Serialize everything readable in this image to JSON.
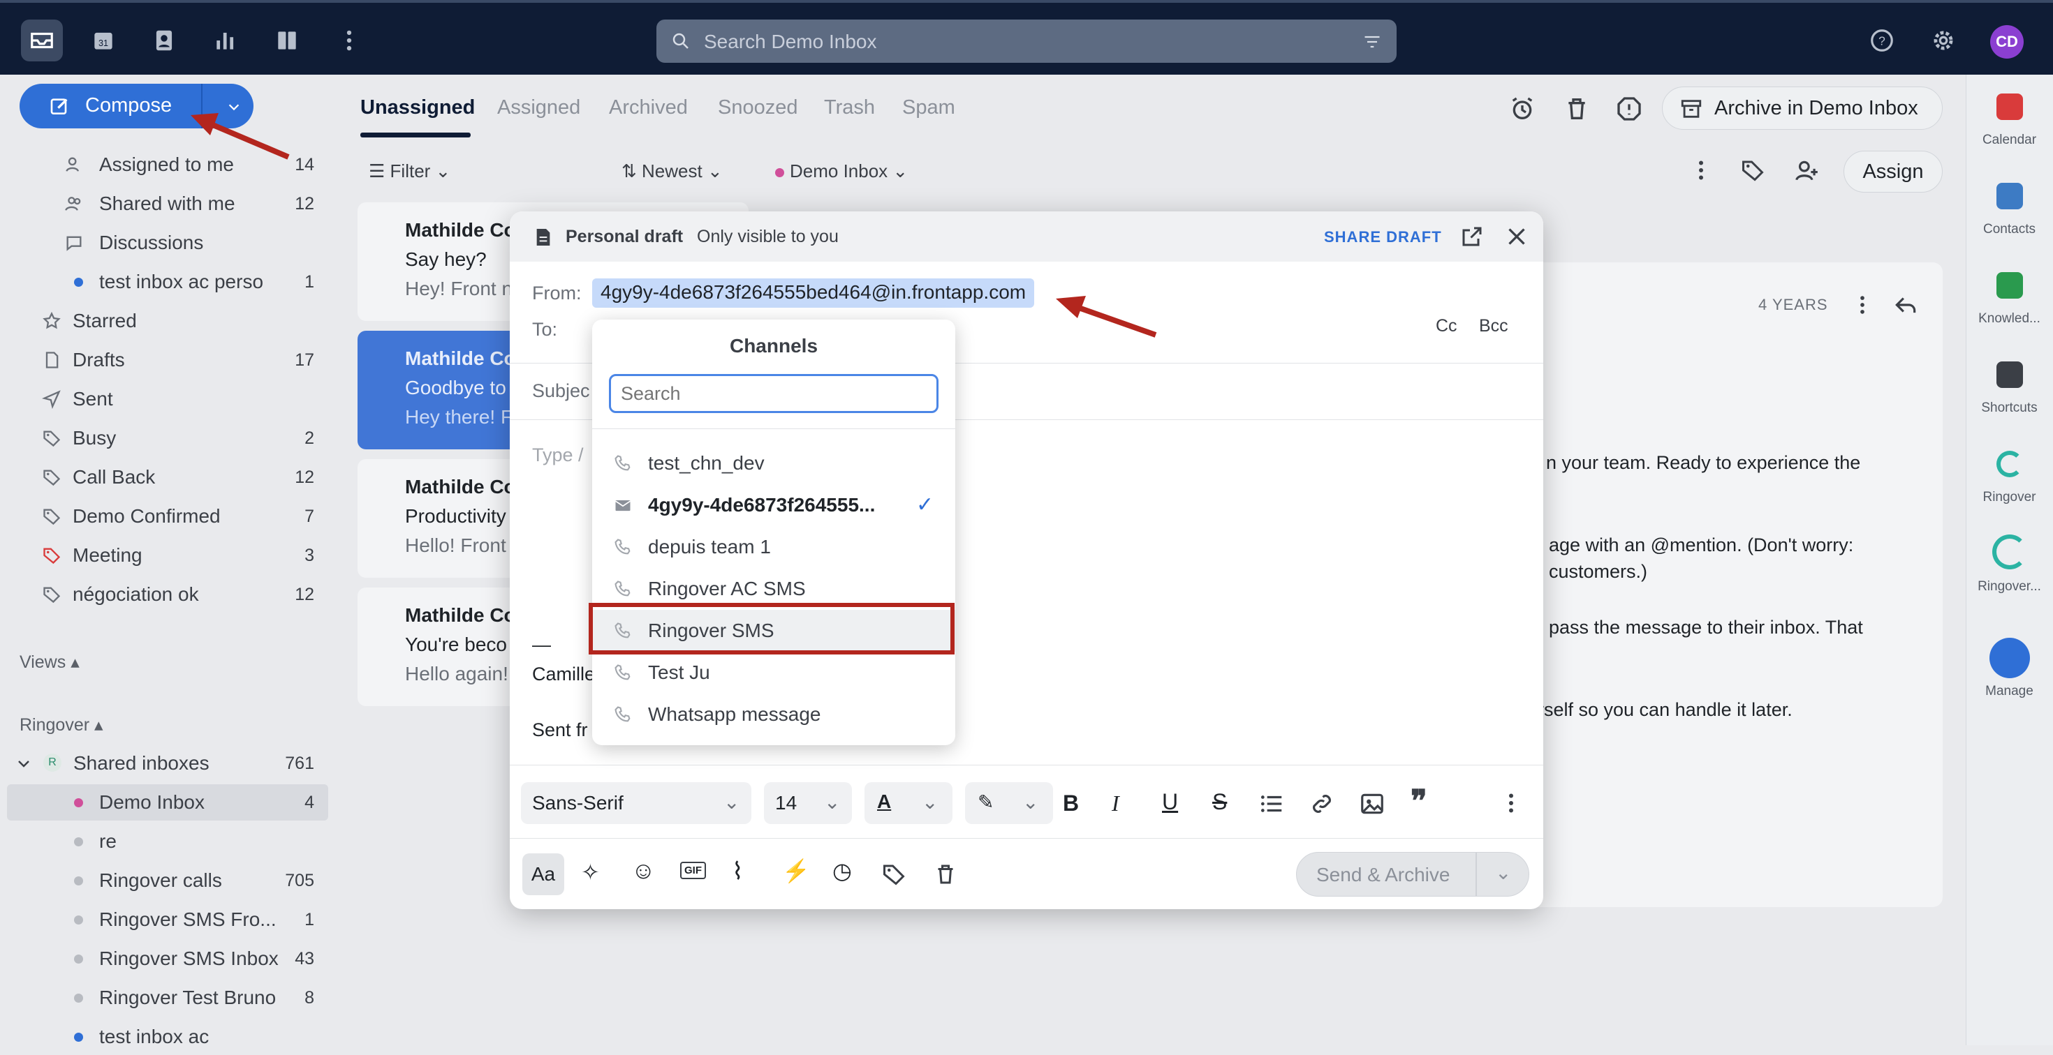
{
  "search": {
    "placeholder": "Search Demo Inbox"
  },
  "user": {
    "initials": "CD"
  },
  "compose": {
    "label": "Compose"
  },
  "sidebar": {
    "items": [
      {
        "label": "Assigned to me",
        "count": "14",
        "icon": "assigned-icon"
      },
      {
        "label": "Shared with me",
        "count": "12",
        "icon": "shared-icon"
      },
      {
        "label": "Discussions",
        "count": "",
        "icon": "chat-icon"
      },
      {
        "label": "test inbox ac perso",
        "count": "1",
        "icon": "dot"
      },
      {
        "label": "Starred",
        "count": "",
        "icon": "star-icon"
      },
      {
        "label": "Drafts",
        "count": "17",
        "icon": "draft-icon"
      },
      {
        "label": "Sent",
        "count": "",
        "icon": "send-icon"
      },
      {
        "label": "Busy",
        "count": "2",
        "icon": "tag-icon"
      },
      {
        "label": "Call Back",
        "count": "12",
        "icon": "tag-icon"
      },
      {
        "label": "Demo Confirmed",
        "count": "7",
        "icon": "tag-icon"
      },
      {
        "label": "Meeting",
        "count": "3",
        "icon": "tag-red-icon"
      },
      {
        "label": "négociation ok",
        "count": "12",
        "icon": "tag-icon"
      }
    ],
    "views_label": "Views",
    "ringover_label": "Ringover",
    "shared_inboxes": {
      "label": "Shared inboxes",
      "count": "761",
      "badge": "R"
    },
    "inboxes": [
      {
        "label": "Demo Inbox",
        "count": "4",
        "color": "#d04f9a"
      },
      {
        "label": "re",
        "count": "",
        "color": "#b8bbc1"
      },
      {
        "label": "Ringover calls",
        "count": "705",
        "color": "#b8bbc1"
      },
      {
        "label": "Ringover SMS Fro...",
        "count": "1",
        "color": "#b8bbc1"
      },
      {
        "label": "Ringover SMS Inbox",
        "count": "43",
        "color": "#b8bbc1"
      },
      {
        "label": "Ringover Test Bruno",
        "count": "8",
        "color": "#b8bbc1"
      },
      {
        "label": "test inbox ac",
        "count": "",
        "color": "#2f6fd6"
      }
    ]
  },
  "tabs": [
    "Unassigned",
    "Assigned",
    "Archived",
    "Snoozed",
    "Trash",
    "Spam"
  ],
  "toolbar": {
    "archive_label": "Archive in Demo Inbox",
    "assign_label": "Assign"
  },
  "filters": {
    "filter": "Filter",
    "sort": "Newest",
    "inbox": "Demo Inbox"
  },
  "conversations": [
    {
      "name": "Mathilde Co",
      "subject": "Say hey?",
      "preview": "Hey! Front n"
    },
    {
      "name": "Mathilde Co",
      "subject": "Goodbye to",
      "preview": "Hey there! F"
    },
    {
      "name": "Mathilde Co",
      "subject": "Productivity",
      "preview": "Hello! Front"
    },
    {
      "name": "Mathilde Co",
      "subject": "You're beco",
      "preview": "Hello again!"
    }
  ],
  "reading": {
    "age": "4 YEARS",
    "lines": [
      "n your team. Ready to experience the",
      "age with an @mention. (Don't worry:",
      "customers.)",
      "pass the message to their inbox. That",
      "rself so you can handle it later."
    ]
  },
  "modal": {
    "title": "Personal draft",
    "subtitle": "Only visible to you",
    "share": "SHARE DRAFT",
    "from_label": "From:",
    "from_value": "4gy9y-4de6873f264555bed464@in.frontapp.com",
    "to_label": "To:",
    "cc": "Cc",
    "bcc": "Bcc",
    "subject_label": "Subjec",
    "body_placeholder": "Type /",
    "sig_dash": "—",
    "sig_name": "Camille",
    "sig_sent": "Sent fr",
    "font": "Sans-Serif",
    "size": "14",
    "aa": "Aa",
    "send": "Send & Archive"
  },
  "channels": {
    "title": "Channels",
    "search_placeholder": "Search",
    "items": [
      {
        "label": "test_chn_dev",
        "icon": "phone-icon"
      },
      {
        "label": "4gy9y-4de6873f264555...",
        "icon": "mail-icon"
      },
      {
        "label": "depuis team 1",
        "icon": "phone-icon"
      },
      {
        "label": "Ringover AC SMS",
        "icon": "phone-icon"
      },
      {
        "label": "Ringover SMS",
        "icon": "phone-icon"
      },
      {
        "label": "Test Ju",
        "icon": "phone-icon"
      },
      {
        "label": "Whatsapp message",
        "icon": "phone-icon"
      }
    ]
  },
  "rail": [
    "Calendar",
    "Contacts",
    "Knowled...",
    "Shortcuts",
    "Ringover",
    "Ringover...",
    "Manage"
  ],
  "colors": {
    "accent": "#2f6fd6",
    "topbar": "#0f1c35",
    "highlight_red": "#b3261e",
    "arrow": "#b3261e"
  }
}
